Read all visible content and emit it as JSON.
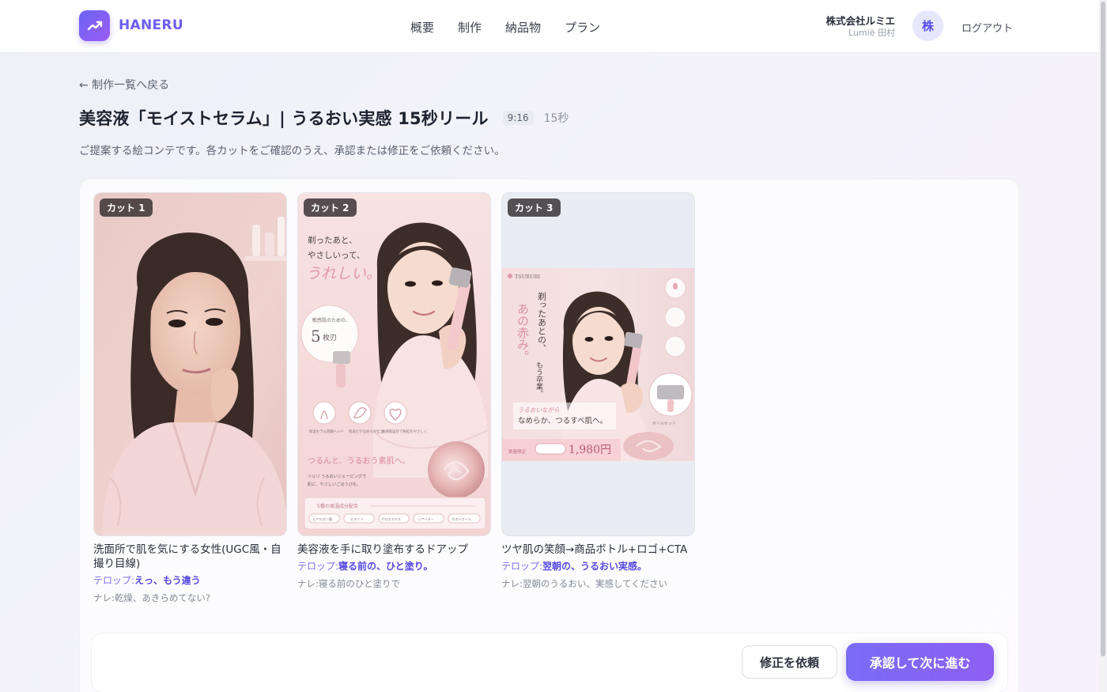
{
  "header": {
    "logo_text": "HANERU",
    "nav": [
      "概要",
      "制作",
      "納品物",
      "プラン"
    ],
    "company_name": "株式会社ルミエ",
    "user_name": "Lumiè 田村",
    "avatar_initial": "株",
    "logout_label": "ログアウト"
  },
  "page": {
    "back_label": "← 制作一覧へ戻る",
    "title": "美容液「モイストセラム」| うるおい実感 15秒リール",
    "ratio": "9:16",
    "duration": "15秒",
    "subtitle": "ご提案する絵コンテです。各カットをご確認のうえ、承認または修正をご依頼ください。"
  },
  "cuts": [
    {
      "badge": "カット 1",
      "description": "洗面所で肌を気にする女性(UGC風・自撮り目線)",
      "telop_label": "テロップ:",
      "telop": "えっ、もう違う",
      "narration": "ナレ:乾燥、あきらめてない?"
    },
    {
      "badge": "カット 2",
      "description": "美容液を手に取り塗布するドアップ",
      "telop_label": "テロップ:",
      "telop": "寝る前の、ひと塗り。",
      "narration": "ナレ:寝る前のひと塗りで",
      "image_text": {
        "headline_1": "剃ったあと、",
        "headline_2": "やさしいって、",
        "headline_3": "うれしい。",
        "circle_small": "敏感肌のための、",
        "circle_big": "5",
        "circle_unit": "枚刃",
        "features": [
          "保湿セラム内蔵ヘッド",
          "肌あたりなめらか仕上",
          "敏感肌設計で負担をやさしく"
        ],
        "tagline": "つるんと、うるおう素肌へ。",
        "body_1": "ツルリ うるおいシェービングで",
        "body_2": "肌に、やさしいごほうびを。",
        "ingredients_title": "5種の保湿成分配合",
        "ingredients": [
          "ヒアルロン酸",
          "セラミド",
          "アロエエキス",
          "シアバター",
          "ホホバオイル"
        ]
      }
    },
    {
      "badge": "カット 3",
      "description": "ツヤ肌の笑顔→商品ボトル+ロゴ+CTA",
      "telop_label": "テロップ:",
      "telop": "翌朝の、うるおい実感。",
      "narration": "ナレ:翌朝のうるおい、実感してください",
      "image_text": {
        "brand": "TSURURI",
        "vertical_1": "剃ったあとの、",
        "vertical_2": "あの赤み。",
        "vertical_3": "もう卒業。",
        "tagline_1": "うるおいながら",
        "tagline_2": "なめらか、つるすべ肌へ。",
        "price": "1,980円",
        "price_prefix": "数量限定",
        "side_note": "ボトルセット"
      }
    }
  ],
  "actions": {
    "revise_label": "修正を依頼",
    "approve_label": "承認して次に進む"
  },
  "colors": {
    "accent": "#7a6cf6",
    "accent_dark": "#5648e0",
    "image_pink": "#f3d6d8"
  }
}
